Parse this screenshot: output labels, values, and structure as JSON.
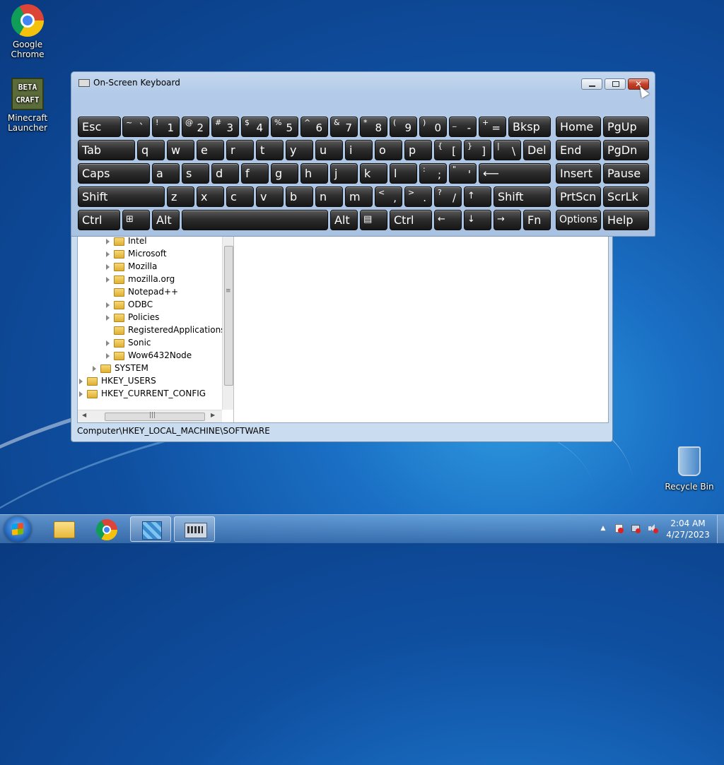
{
  "desktop": {
    "icons": [
      {
        "label": "Google Chrome"
      },
      {
        "label": "Minecraft Launcher",
        "logo_text": "BETA CRAFT"
      },
      {
        "label": "Recycle Bin"
      }
    ]
  },
  "osk": {
    "title": "On-Screen Keyboard",
    "close_glyph": "✕",
    "keys": {
      "esc": "Esc",
      "grave_sub": "~",
      "grave_main": "`",
      "d1_sub": "!",
      "d1": "1",
      "d2_sub": "@",
      "d2": "2",
      "d3_sub": "#",
      "d3": "3",
      "d4_sub": "$",
      "d4": "4",
      "d5_sub": "%",
      "d5": "5",
      "d6_sub": "^",
      "d6": "6",
      "d7_sub": "&",
      "d7": "7",
      "d8_sub": "*",
      "d8": "8",
      "d9_sub": "(",
      "d9": "9",
      "d0_sub": ")",
      "d0": "0",
      "minus_sub": "_",
      "minus": "-",
      "plus_sub": "+",
      "plus": "=",
      "bksp": "Bksp",
      "home": "Home",
      "pgup": "PgUp",
      "tab": "Tab",
      "q": "q",
      "w": "w",
      "e": "e",
      "r": "r",
      "t": "t",
      "y": "y",
      "u": "u",
      "i": "i",
      "o": "o",
      "p": "p",
      "lbr_sub": "{",
      "lbr": "[",
      "rbr_sub": "}",
      "rbr": "]",
      "bsl_sub": "|",
      "bsl": "\\",
      "del": "Del",
      "end": "End",
      "pgdn": "PgDn",
      "caps": "Caps",
      "a": "a",
      "s": "s",
      "d": "d",
      "f": "f",
      "g": "g",
      "h": "h",
      "j": "j",
      "k": "k",
      "l": "l",
      "semi_sub": ":",
      "semi": ";",
      "quote_sub": "\"",
      "quote": "'",
      "enter": "⟵",
      "insert": "Insert",
      "pause": "Pause",
      "shift": "Shift",
      "z": "z",
      "x": "x",
      "c": "c",
      "v": "v",
      "b": "b",
      "n": "n",
      "m": "m",
      "comma_sub": "<",
      "comma": ",",
      "period_sub": ">",
      "period": ".",
      "slash_sub": "?",
      "slash": "/",
      "up": "↑",
      "prtscn": "PrtScn",
      "scrlk": "ScrLk",
      "ctrl": "Ctrl",
      "win": "⊞",
      "alt": "Alt",
      "menu": "▤",
      "left": "←",
      "down": "↓",
      "right": "→",
      "fn": "Fn",
      "options": "Options",
      "help": "Help"
    }
  },
  "registry": {
    "tree": [
      {
        "label": "Intel"
      },
      {
        "label": "Microsoft"
      },
      {
        "label": "Mozilla"
      },
      {
        "label": "mozilla.org"
      },
      {
        "label": "Notepad++"
      },
      {
        "label": "ODBC"
      },
      {
        "label": "Policies"
      },
      {
        "label": "RegisteredApplications"
      },
      {
        "label": "Sonic"
      },
      {
        "label": "Wow6432Node"
      },
      {
        "label": "SYSTEM"
      },
      {
        "label": "HKEY_USERS"
      },
      {
        "label": "HKEY_CURRENT_CONFIG"
      }
    ],
    "status_path": "Computer\\HKEY_LOCAL_MACHINE\\SOFTWARE",
    "scroll_grip": "≡",
    "hscroll_grip": "|||"
  },
  "taskbar": {
    "clock_time": "2:04 AM",
    "clock_date": "4/27/2023",
    "tray_chevron": "▲"
  }
}
